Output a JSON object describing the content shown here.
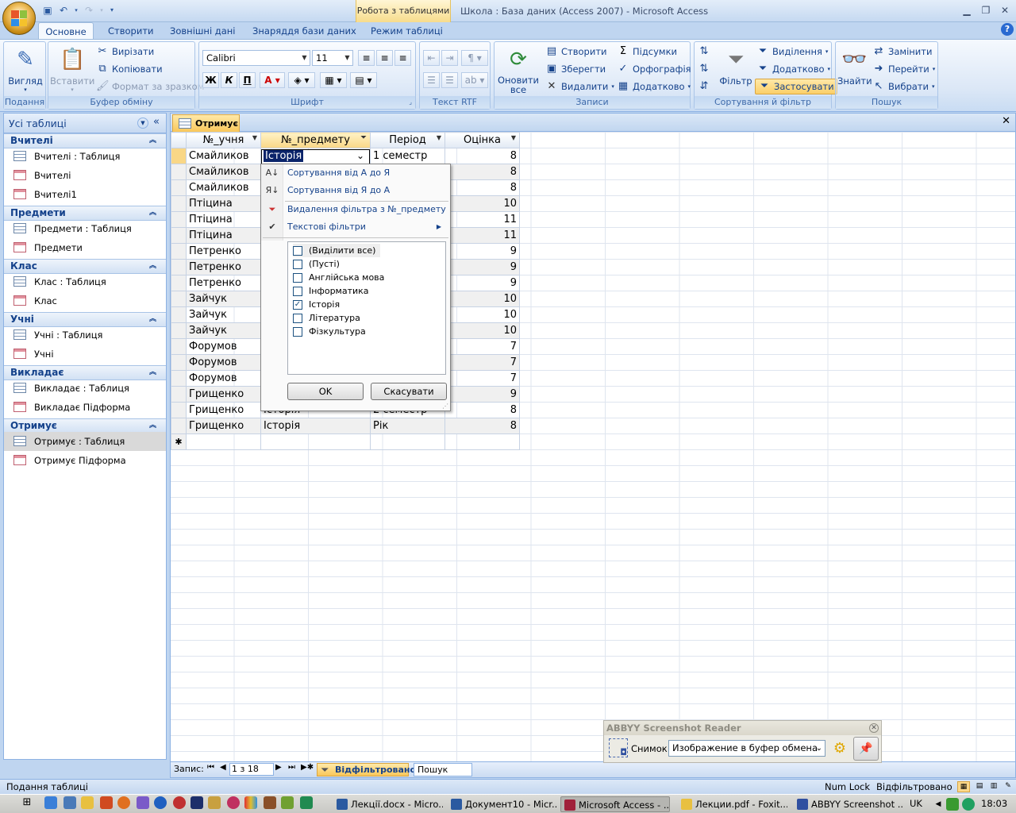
{
  "title_bar": {
    "context_tab": "Робота з таблицями",
    "window_title": "Школа : База даних (Access 2007) - Microsoft Access"
  },
  "ribbon_tabs": [
    "Основне",
    "Створити",
    "Зовнішні дані",
    "Знаряддя бази даних",
    "Режим таблиці"
  ],
  "ribbon": {
    "views": {
      "label": "Подання",
      "button": "Вигляд"
    },
    "clipboard": {
      "label": "Буфер обміну",
      "paste": "Вставити",
      "cut": "Вирізати",
      "copy": "Копіювати",
      "format_painter": "Формат за зразком"
    },
    "font": {
      "label": "Шрифт",
      "font_name": "Calibri",
      "font_size": "11"
    },
    "rich_text": {
      "label": "Текст RTF"
    },
    "records": {
      "label": "Записи",
      "refresh": "Оновити все",
      "new": "Створити",
      "save": "Зберегти",
      "delete": "Видалити",
      "totals": "Підсумки",
      "spelling": "Орфографія",
      "more": "Додатково"
    },
    "sort_filter": {
      "label": "Сортування й фільтр",
      "filter": "Фільтр",
      "selection": "Виділення",
      "advanced": "Додатково",
      "toggle": "Застосувати"
    },
    "find": {
      "label": "Пошук",
      "find": "Знайти",
      "replace": "Замінити",
      "goto": "Перейти",
      "select": "Вибрати"
    }
  },
  "nav_pane": {
    "header": "Усі таблиці",
    "groups": [
      {
        "name": "Вчителі",
        "items": [
          {
            "label": "Вчителі : Таблиця",
            "kind": "table"
          },
          {
            "label": "Вчителі",
            "kind": "form"
          },
          {
            "label": "Вчителі1",
            "kind": "form"
          }
        ]
      },
      {
        "name": "Предмети",
        "items": [
          {
            "label": "Предмети : Таблиця",
            "kind": "table"
          },
          {
            "label": "Предмети",
            "kind": "form"
          }
        ]
      },
      {
        "name": "Клас",
        "items": [
          {
            "label": "Клас : Таблиця",
            "kind": "table"
          },
          {
            "label": "Клас",
            "kind": "form"
          }
        ]
      },
      {
        "name": "Учні",
        "items": [
          {
            "label": "Учні : Таблиця",
            "kind": "table"
          },
          {
            "label": "Учні",
            "kind": "form"
          }
        ]
      },
      {
        "name": "Викладає",
        "items": [
          {
            "label": "Викладає : Таблиця",
            "kind": "table"
          },
          {
            "label": "Викладає Підформа",
            "kind": "form"
          }
        ]
      },
      {
        "name": "Отримує",
        "items": [
          {
            "label": "Отримує : Таблиця",
            "kind": "table",
            "selected": true
          },
          {
            "label": "Отримує Підформа",
            "kind": "form"
          }
        ]
      }
    ]
  },
  "document": {
    "tab_label": "Отримує",
    "columns": [
      "№_учня",
      "№_предмету",
      "Період",
      "Оцінка"
    ],
    "rows": [
      [
        "Смайликов",
        "Історія",
        "1 семестр",
        "8"
      ],
      [
        "Смайликов",
        "",
        "",
        "8"
      ],
      [
        "Смайликов",
        "",
        "",
        "8"
      ],
      [
        "Птіцина",
        "",
        "",
        "10"
      ],
      [
        "Птіцина",
        "",
        "",
        "11"
      ],
      [
        "Птіцина",
        "",
        "",
        "11"
      ],
      [
        "Петренко",
        "",
        "",
        "9"
      ],
      [
        "Петренко",
        "",
        "",
        "9"
      ],
      [
        "Петренко",
        "",
        "",
        "9"
      ],
      [
        "Зайчук",
        "",
        "",
        "10"
      ],
      [
        "Зайчук",
        "",
        "",
        "10"
      ],
      [
        "Зайчук",
        "",
        "",
        "10"
      ],
      [
        "Форумов",
        "",
        "",
        "7"
      ],
      [
        "Форумов",
        "",
        "",
        "7"
      ],
      [
        "Форумов",
        "",
        "",
        "7"
      ],
      [
        "Грищенко",
        "",
        "",
        "9"
      ],
      [
        "Грищенко",
        "Історія",
        "2 семестр",
        "8"
      ],
      [
        "Грищенко",
        "Історія",
        "Рік",
        "8"
      ]
    ],
    "new_row_marker": "✱",
    "record_nav": {
      "label": "Запис:",
      "position": "1 з 18",
      "filter_status": "Відфільтровано",
      "search": "Пошук"
    }
  },
  "filter_menu": {
    "sort_asc": "Сортування від А до Я",
    "sort_desc": "Сортування від Я до А",
    "clear_filter": "Видалення фільтра з №_предмету",
    "text_filters": "Текстові фільтри",
    "values": [
      {
        "label": "(Виділити все)",
        "checked": false
      },
      {
        "label": "(Пусті)",
        "checked": false
      },
      {
        "label": "Англійська мова",
        "checked": false
      },
      {
        "label": "Інформатика",
        "checked": false
      },
      {
        "label": "Історія",
        "checked": true
      },
      {
        "label": "Література",
        "checked": false
      },
      {
        "label": "Фізкультура",
        "checked": false
      }
    ],
    "ok": "OK",
    "cancel": "Скасувати"
  },
  "abbyy": {
    "title": "ABBYY Screenshot Reader",
    "snapshot_label": "Снимок",
    "mode": "Изображение в буфер обмена"
  },
  "status_bar": {
    "left": "Подання таблиці",
    "num_lock": "Num Lock",
    "filtered": "Відфільтровано"
  },
  "taskbar": {
    "items": [
      "Лекції.docx - Micro...",
      "Документ10 - Micr...",
      "Microsoft Access - ...",
      "Лекции.pdf - Foxit...",
      "ABBYY Screenshot ..."
    ],
    "lang": "UK",
    "clock": "18:03"
  },
  "colors": {
    "accent_orange": "#f9c75a",
    "ribbon_blue": "#15428b",
    "selection": "#0a246a"
  }
}
